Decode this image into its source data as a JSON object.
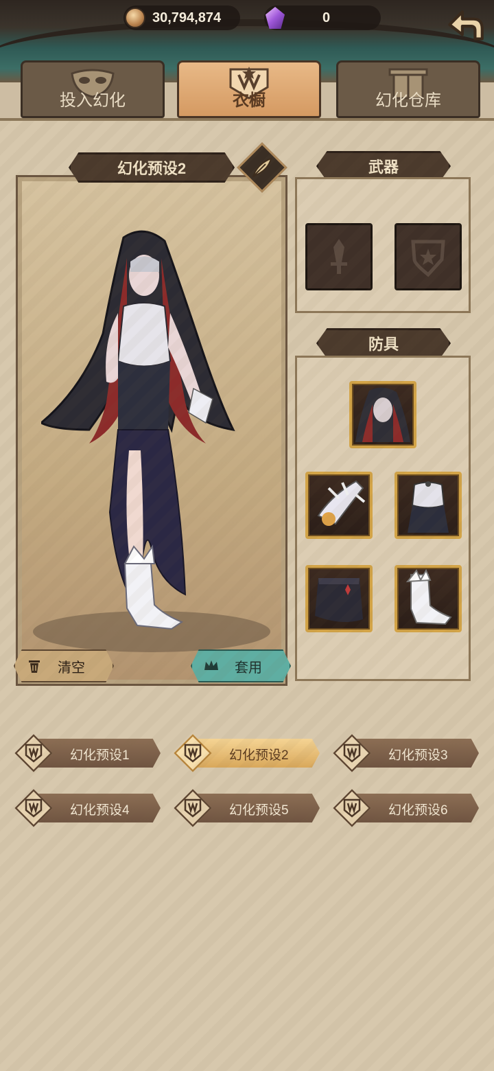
{
  "topbar": {
    "gold_amount": "30,794,874",
    "gem_amount": "0",
    "back_icon": "back-arrow-icon"
  },
  "tabs": [
    {
      "label": "投入幻化",
      "icon": "mask-icon",
      "active": false
    },
    {
      "label": "衣橱",
      "icon": "wardrobe-crest-icon",
      "active": true
    },
    {
      "label": "幻化仓库",
      "icon": "cabinet-icon",
      "active": false
    }
  ],
  "preview": {
    "preset_name": "幻化预设2",
    "clear_label": "清空",
    "apply_label": "套用"
  },
  "sections": {
    "weapons_title": "武器",
    "armor_title": "防具"
  },
  "presets": [
    {
      "label": "幻化预设1",
      "active": false
    },
    {
      "label": "幻化预设2",
      "active": true
    },
    {
      "label": "幻化预设3",
      "active": false
    },
    {
      "label": "幻化预设4",
      "active": false
    },
    {
      "label": "幻化预设5",
      "active": false
    },
    {
      "label": "幻化预设6",
      "active": false
    }
  ],
  "colors": {
    "accent_gold": "#d3a447",
    "apply_teal": "#5faea2",
    "panel_parchment": "#d7c8ad"
  }
}
